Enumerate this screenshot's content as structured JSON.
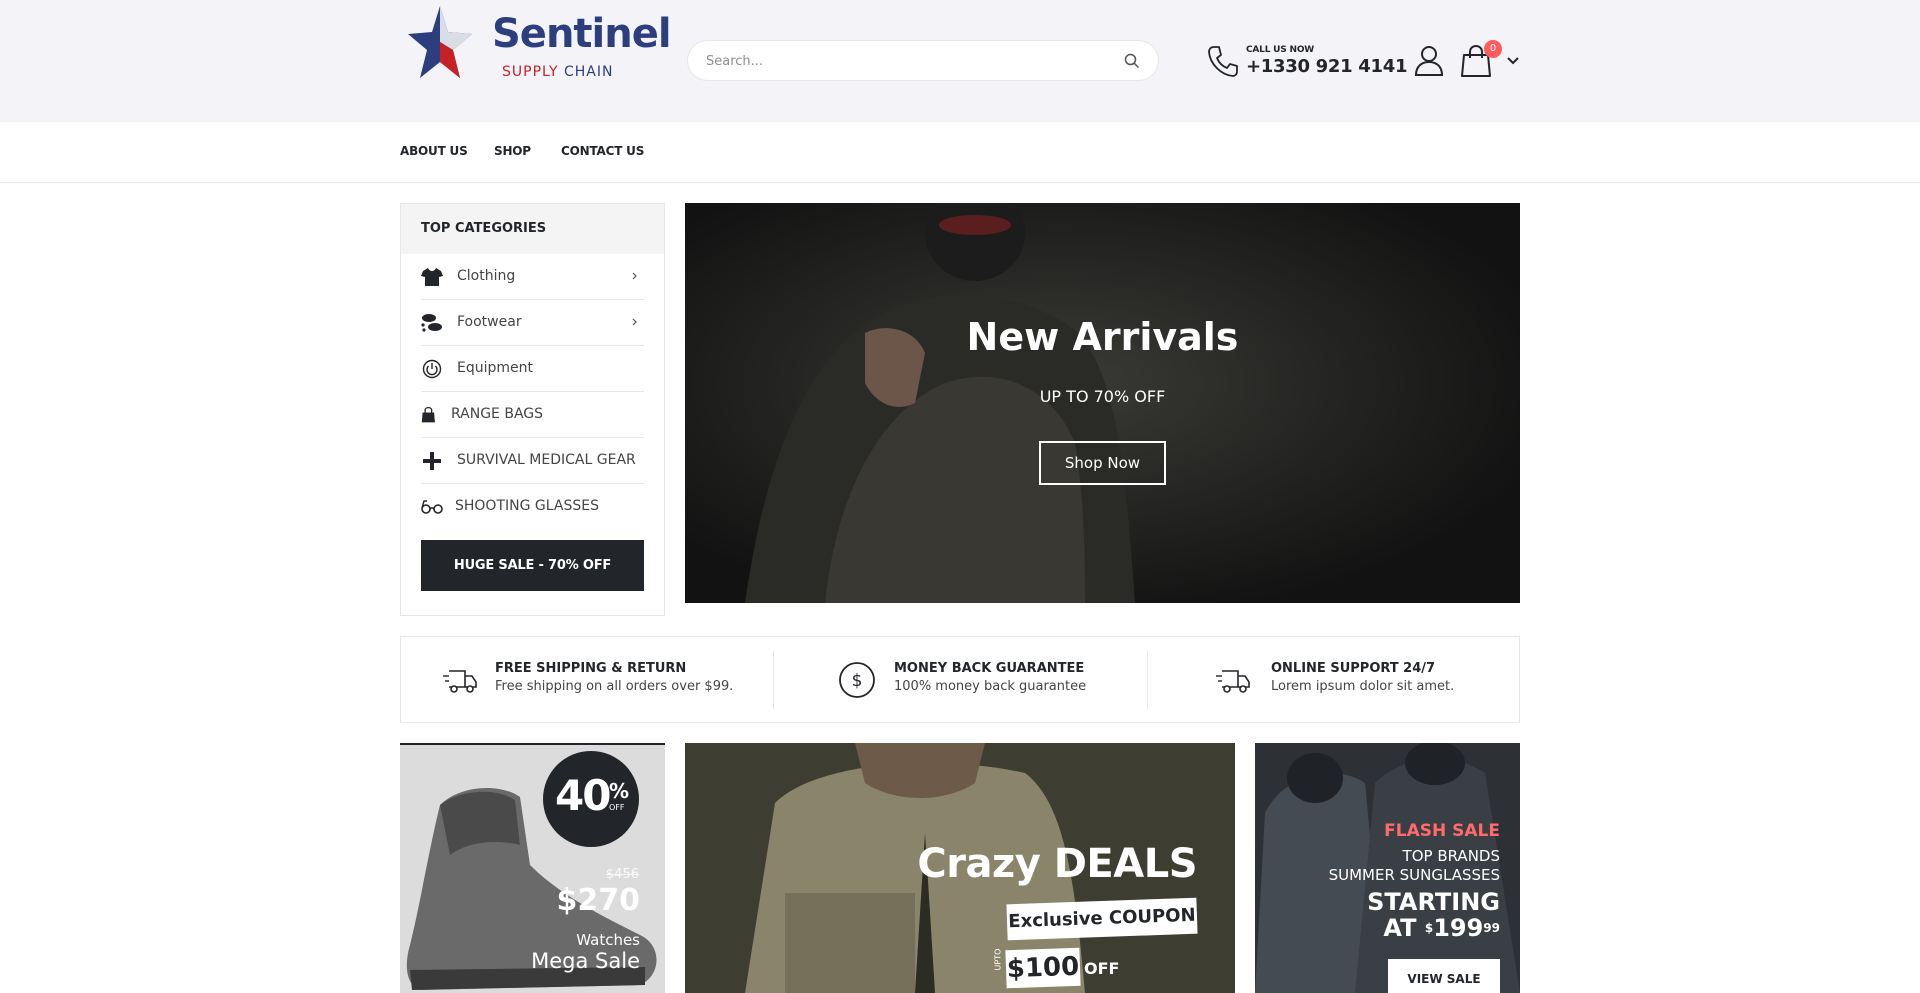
{
  "logo": {
    "name": "Sentinel",
    "tagline_red": "SUPPLY",
    "tagline_dark": "CHAIN"
  },
  "search": {
    "placeholder": "Search..."
  },
  "contact": {
    "label": "CALL US NOW",
    "number": "+1330 921 4141"
  },
  "cart": {
    "count": "0"
  },
  "nav": [
    "ABOUT US",
    "SHOP",
    "CONTACT US"
  ],
  "sidebar": {
    "title": "TOP CATEGORIES",
    "items": [
      {
        "label": "Clothing",
        "icon": "tshirt-icon",
        "has_submenu": true
      },
      {
        "label": "Footwear",
        "icon": "footprints-icon",
        "has_submenu": true
      },
      {
        "label": "Equipment",
        "icon": "power-icon",
        "has_submenu": false
      },
      {
        "label": "RANGE BAGS",
        "icon": "bag-icon",
        "has_submenu": false
      },
      {
        "label": "SURVIVAL MEDICAL GEAR",
        "icon": "plus-icon",
        "has_submenu": false
      },
      {
        "label": "SHOOTING GLASSES",
        "icon": "glasses-icon",
        "has_submenu": false
      }
    ],
    "sale_button": "HUGE SALE - 70% OFF"
  },
  "hero": {
    "title": "New Arrivals",
    "subtitle": "UP TO 70% OFF",
    "button": "Shop Now"
  },
  "info": [
    {
      "title": "FREE SHIPPING & RETURN",
      "text": "Free shipping on all orders over $99.",
      "icon": "truck-icon"
    },
    {
      "title": "MONEY BACK GUARANTEE",
      "text": "100% money back guarantee",
      "icon": "dollar-circle-icon"
    },
    {
      "title": "ONLINE SUPPORT 24/7",
      "text": "Lorem ipsum dolor sit amet.",
      "icon": "truck-icon"
    }
  ],
  "banner1": {
    "discount": "40",
    "percent": "%",
    "off": "OFF",
    "old_price": "$456",
    "new_price": "$270",
    "category": "Watches",
    "title": "Mega Sale"
  },
  "banner2": {
    "headline": "Crazy DEALS",
    "coupon": "Exclusive COUPON",
    "upto": "UPTO",
    "amount": "$100",
    "off": "OFF"
  },
  "banner3": {
    "flash": "FLASH SALE",
    "line1": "TOP BRANDS",
    "line2": "SUMMER SUNGLASSES",
    "starting": "STARTING",
    "at": "AT",
    "currency": "$",
    "price": "199",
    "cents": "99",
    "button": "VIEW SALE"
  },
  "colors": {
    "dark": "#222529",
    "badge": "#ff5b5b",
    "flash": "#ff6b6b",
    "brand_blue": "#2c3e7e",
    "brand_red": "#c62127"
  }
}
